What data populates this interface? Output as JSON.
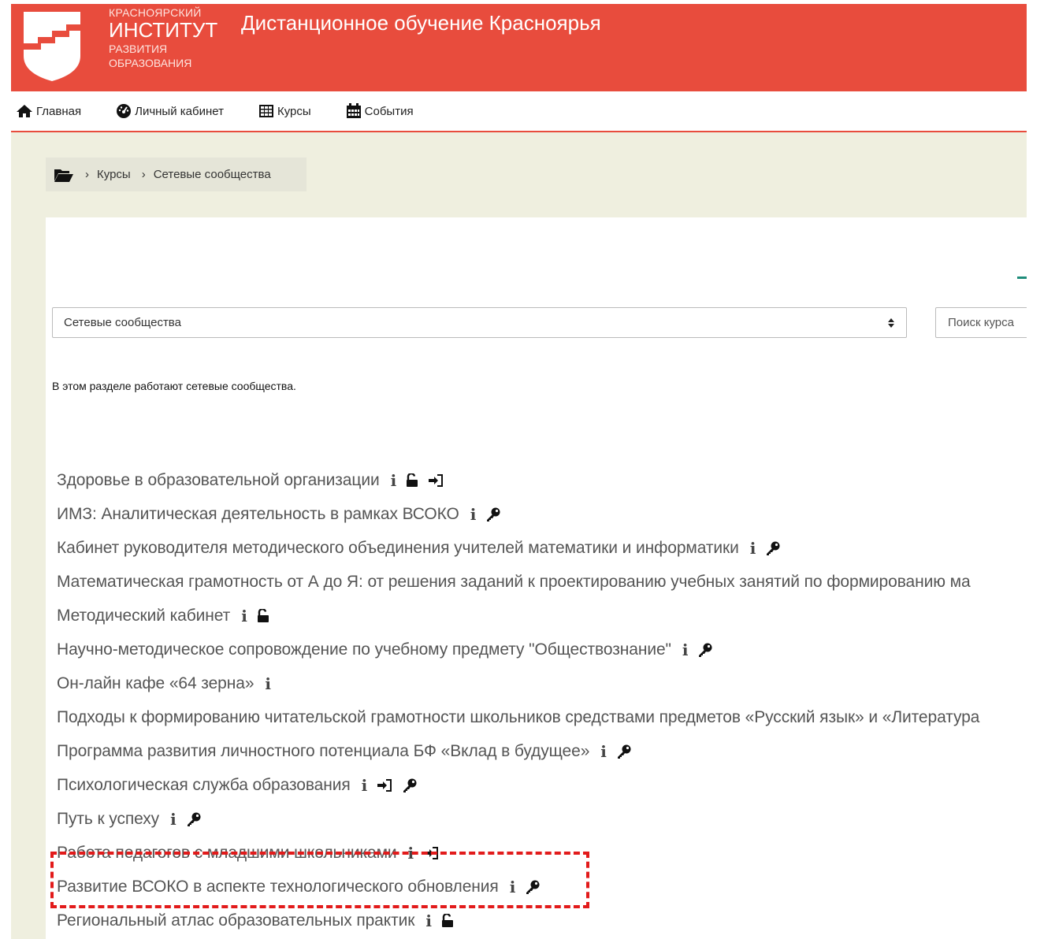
{
  "header": {
    "logo": {
      "line1": "КРАСНОЯРСКИЙ",
      "line2": "ИНСТИТУТ",
      "line3": "РАЗВИТИЯ",
      "line4": "ОБРАЗОВАНИЯ"
    },
    "site_title": "Дистанционное обучение Красноярья"
  },
  "nav": {
    "items": [
      {
        "label": "Главная",
        "icon": "home-icon"
      },
      {
        "label": "Личный кабинет",
        "icon": "dashboard-icon"
      },
      {
        "label": "Курсы",
        "icon": "grid-icon"
      },
      {
        "label": "События",
        "icon": "calendar-icon"
      }
    ]
  },
  "breadcrumb": {
    "items": [
      "Курсы",
      "Сетевые сообщества"
    ]
  },
  "category_select": {
    "value": "Сетевые сообщества"
  },
  "search": {
    "label": "Поиск курса"
  },
  "description": "В этом разделе работают сетевые сообщества.",
  "courses": [
    {
      "name": "Здоровье в образовательной организации",
      "icons": [
        "info",
        "unlock",
        "sign-in"
      ]
    },
    {
      "name": "ИМЗ: Аналитическая деятельность в рамках ВСОКО",
      "icons": [
        "info",
        "key"
      ]
    },
    {
      "name": "Кабинет руководителя методического объединения учителей математики и информатики",
      "icons": [
        "info",
        "key"
      ]
    },
    {
      "name": "Математическая грамотность от А до Я: от решения заданий к проектированию учебных занятий по формированию ма",
      "icons": []
    },
    {
      "name": "Методический кабинет",
      "icons": [
        "info",
        "unlock"
      ]
    },
    {
      "name": "Научно-методическое сопровождение по учебному предмету \"Обществознание\"",
      "icons": [
        "info",
        "key"
      ]
    },
    {
      "name": "Он-лайн кафе «64 зерна»",
      "icons": [
        "info"
      ]
    },
    {
      "name": "Подходы к формированию читательской грамотности школьников средствами предметов «Русский язык» и «Литература",
      "icons": []
    },
    {
      "name": "Программа развития личностного потенциала БФ «Вклад в будущее»",
      "icons": [
        "info",
        "key"
      ]
    },
    {
      "name": "Психологическая служба образования",
      "icons": [
        "info",
        "sign-in",
        "key"
      ]
    },
    {
      "name": "Путь к успеху",
      "icons": [
        "info",
        "key"
      ]
    },
    {
      "name": "Работа педагогов с младшими школьниками",
      "icons": [
        "info",
        "sign-in"
      ]
    },
    {
      "name": "Развитие ВСОКО в аспекте технологического обновления",
      "icons": [
        "info",
        "key"
      ]
    },
    {
      "name": "Региональный атлас образовательных практик",
      "icons": [
        "info",
        "unlock"
      ]
    }
  ],
  "colors": {
    "brand": "#e84c3d",
    "page_bg": "#efefdf",
    "highlight": "#e21b1b"
  }
}
